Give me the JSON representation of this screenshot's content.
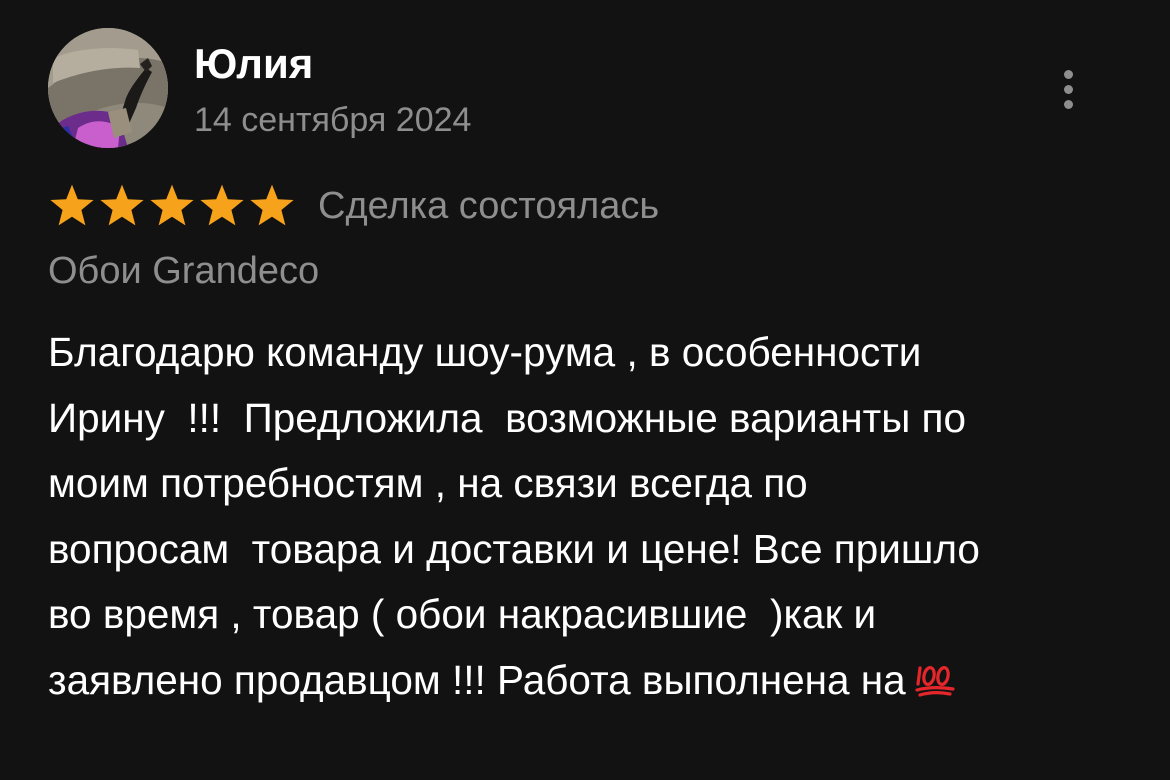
{
  "review": {
    "author": {
      "name": "Юлия",
      "date": "14 сентября 2024",
      "avatar_icon": "user-photo-avatar"
    },
    "more_icon": "more-vertical-icon",
    "rating": {
      "stars": 5,
      "max": 5,
      "star_color": "#F7A21B",
      "status": "Сделка состоялась"
    },
    "product": "Обои Grandeco",
    "text_lines": [
      "Благодарю команду шоу-рума , в особенности",
      "Ирину  !!!  Предложила  возможные варианты по",
      "моим потребностям , на связи всегда по",
      "вопросам  товара и доставки и цене! Все пришло",
      "во время , товар ( обои накрасившие  )как и",
      "заявлено продавцом !!! Работа выполнена на"
    ],
    "trailing_emoji": "hundred-points-emoji"
  },
  "colors": {
    "background": "#121212",
    "primary_text": "#FFFFFF",
    "secondary_text": "#8E8E8E",
    "accent_emoji": "#E5262B"
  }
}
